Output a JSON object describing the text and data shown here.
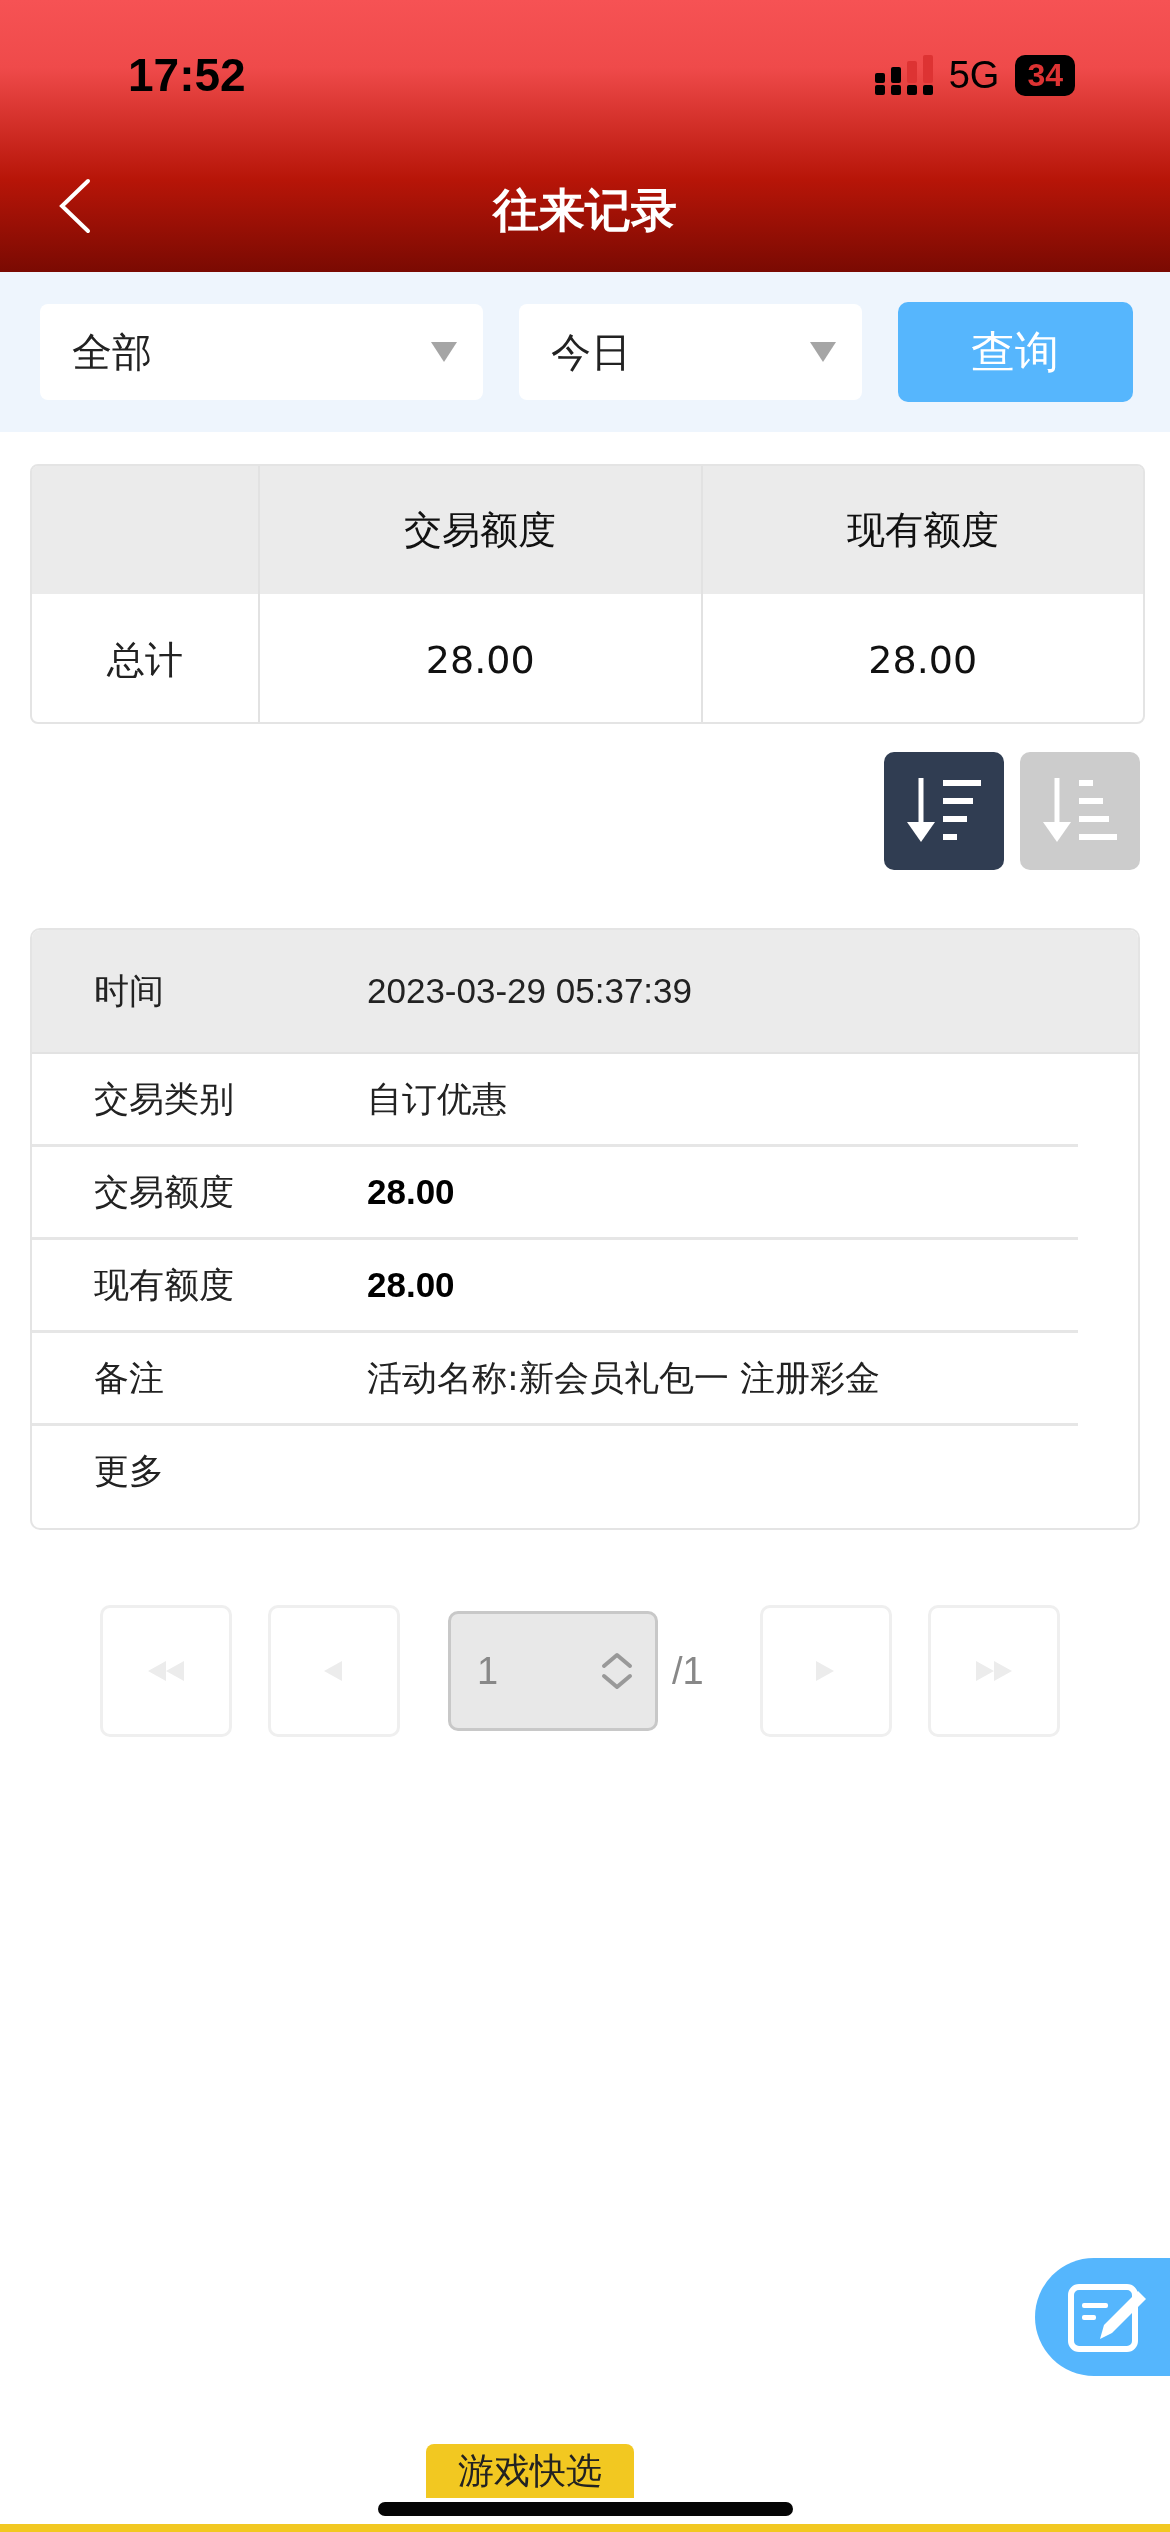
{
  "status_bar": {
    "time": "17:52",
    "network": "5G",
    "battery": "34"
  },
  "header": {
    "title": "往来记录"
  },
  "filters": {
    "selects": [
      {
        "value": "全部"
      },
      {
        "value": "今日"
      }
    ],
    "query_button": "查询"
  },
  "summary_table": {
    "columns": [
      "交易额度",
      "现有额度"
    ],
    "rows": [
      {
        "label": "总计",
        "cells": [
          "28.00",
          "28.00"
        ]
      }
    ]
  },
  "sort_buttons": [
    {
      "kind": "descending",
      "selected": true
    },
    {
      "kind": "ascending",
      "selected": false
    }
  ],
  "record": {
    "header": {
      "label": "时间",
      "value": "2023-03-29 05:37:39"
    },
    "rows": [
      {
        "label": "交易类别",
        "value": "自订优惠",
        "bold": false
      },
      {
        "label": "交易额度",
        "value": "28.00",
        "bold": true
      },
      {
        "label": "现有额度",
        "value": "28.00",
        "bold": true
      },
      {
        "label": "备注",
        "value": "活动名称:新会员礼包一 注册彩金",
        "bold": false
      },
      {
        "label": "更多"
      }
    ]
  },
  "pagination": {
    "buttons": [
      {
        "kind": "first",
        "disabled": true
      },
      {
        "kind": "prev",
        "disabled": true
      },
      {
        "kind": "next",
        "disabled": true
      },
      {
        "kind": "last",
        "disabled": true
      }
    ],
    "page": "1",
    "total": "/1"
  },
  "bottom_tab": {
    "label": "游戏快选"
  }
}
